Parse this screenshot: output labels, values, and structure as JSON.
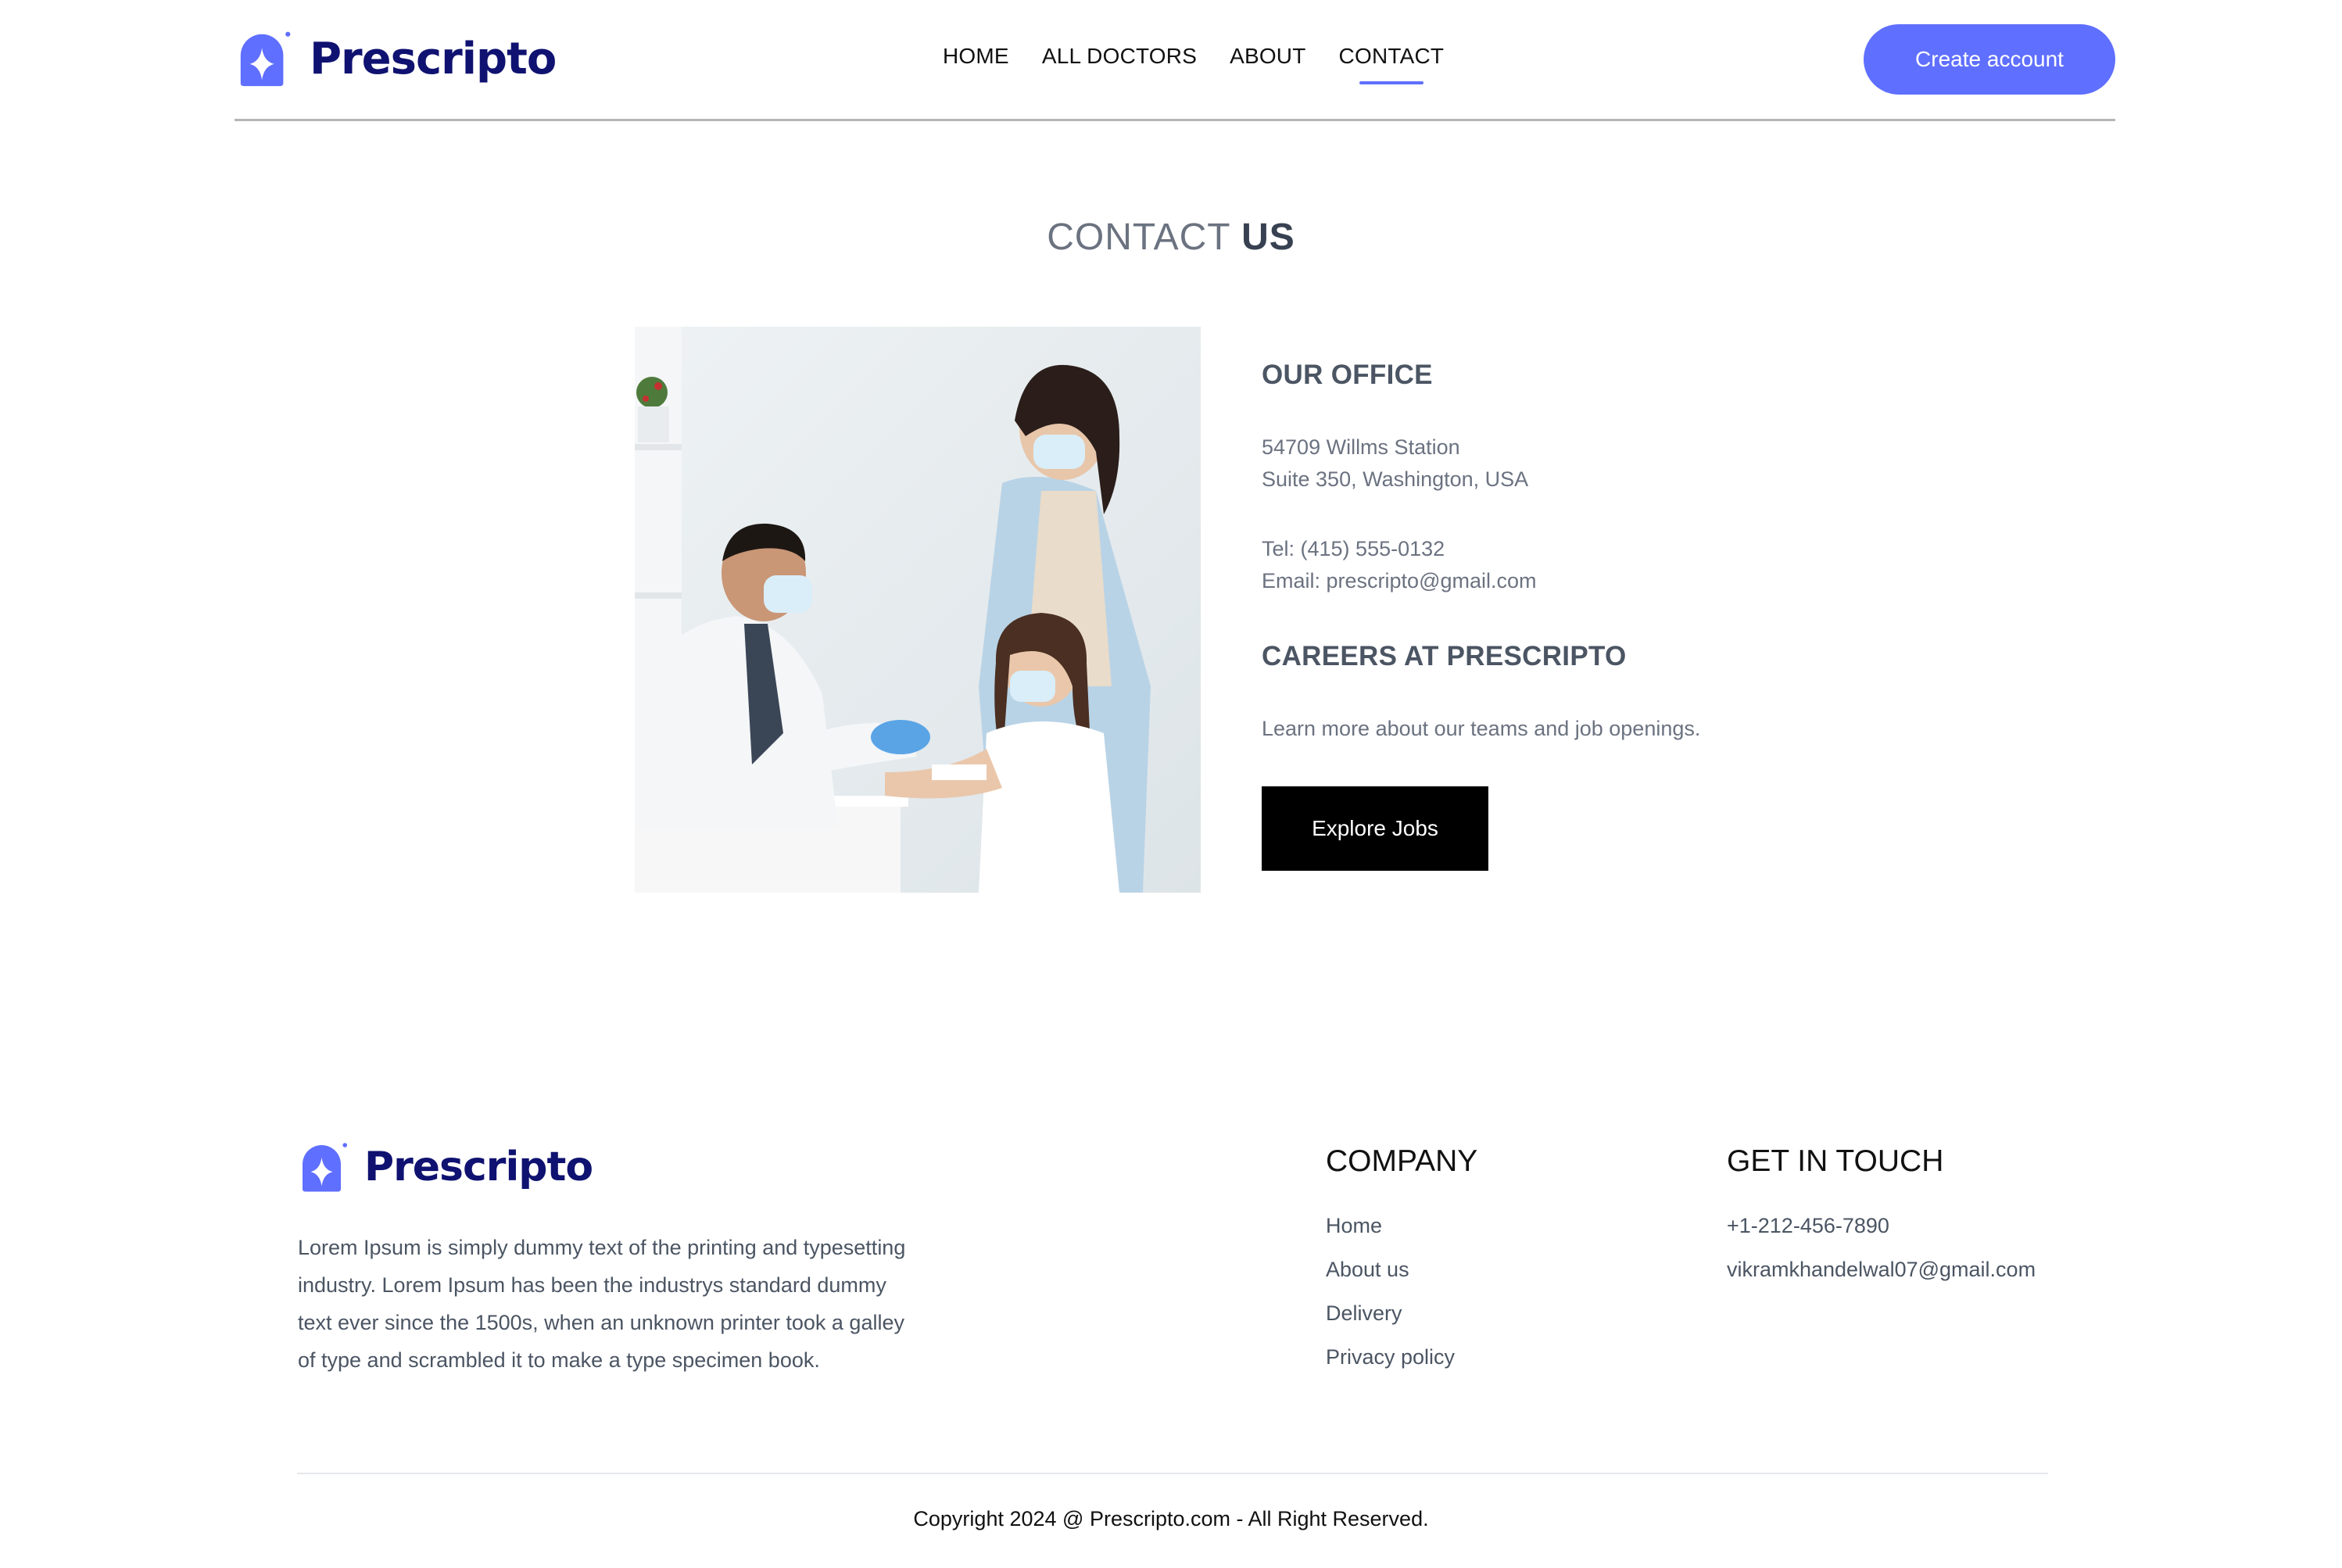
{
  "brand": {
    "name": "Prescripto",
    "color": "#5f6fff",
    "text_color": "#0f1270"
  },
  "header": {
    "nav": [
      {
        "label": "HOME",
        "active": false
      },
      {
        "label": "ALL DOCTORS",
        "active": false
      },
      {
        "label": "ABOUT",
        "active": false
      },
      {
        "label": "CONTACT",
        "active": true
      }
    ],
    "create_account_label": "Create account"
  },
  "page": {
    "title_light": "CONTACT",
    "title_bold": "US"
  },
  "contact": {
    "image_icon": "doctor-vaccinating-child-photo",
    "office_heading": "OUR OFFICE",
    "address_line1": "54709 Willms Station",
    "address_line2": "Suite 350, Washington, USA",
    "tel": "Tel: (415) 555-0132",
    "email": "Email: prescripto@gmail.com",
    "careers_heading": "CAREERS AT PRESCRIPTO",
    "careers_text": "Learn more about our teams and job openings.",
    "explore_label": "Explore Jobs"
  },
  "footer": {
    "description": "Lorem Ipsum is simply dummy text of the printing and typesetting industry. Lorem Ipsum has been the industrys standard dummy text ever since the 1500s, when an unknown printer took a galley of type and scrambled it to make a type specimen book.",
    "company_heading": "COMPANY",
    "company_links": [
      "Home",
      "About us",
      "Delivery",
      "Privacy policy"
    ],
    "touch_heading": "GET IN TOUCH",
    "phone": "+1-212-456-7890",
    "email": "vikramkhandelwal07@gmail.com",
    "copyright": "Copyright 2024 @ Prescripto.com - All Right Reserved."
  }
}
